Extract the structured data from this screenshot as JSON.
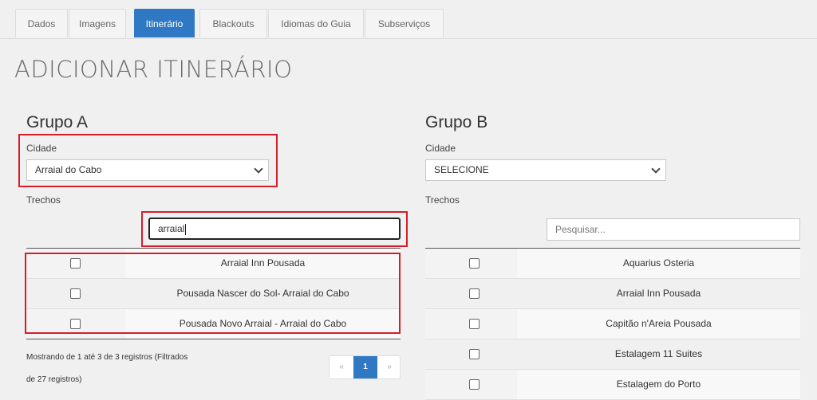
{
  "tabs": [
    {
      "label": "Dados",
      "active": false
    },
    {
      "label": "Imagens",
      "active": false
    },
    {
      "label": "Itinerário",
      "active": true
    },
    {
      "label": "Blackouts",
      "active": false
    },
    {
      "label": "Idiomas do Guia",
      "active": false
    },
    {
      "label": "Subserviços",
      "active": false
    }
  ],
  "page_title": "ADICIONAR ITINERÁRIO",
  "group_a": {
    "title": "Grupo A",
    "city_label": "Cidade",
    "city_value": "Arraial do Cabo",
    "trechos_label": "Trechos",
    "search_value": "arraial",
    "rows": [
      {
        "name": "Arraial Inn Pousada",
        "checked": false
      },
      {
        "name": "Pousada Nascer do Sol- Arraial do Cabo",
        "checked": false
      },
      {
        "name": "Pousada Novo Arraial - Arraial do Cabo",
        "checked": false
      }
    ],
    "info_line1": "Mostrando de 1 até 3 de 3 registros (Filtrados",
    "info_line2": "de 27 registros)",
    "pagination": {
      "prev": "«",
      "current": "1",
      "next": "»"
    }
  },
  "group_b": {
    "title": "Grupo B",
    "city_label": "Cidade",
    "city_value": "SELECIONE",
    "trechos_label": "Trechos",
    "search_placeholder": "Pesquisar...",
    "rows": [
      {
        "name": "Aquarius Osteria",
        "checked": false
      },
      {
        "name": "Arraial Inn Pousada",
        "checked": false
      },
      {
        "name": "Capitão n'Areia Pousada",
        "checked": false
      },
      {
        "name": "Estalagem 11 Suites",
        "checked": false
      },
      {
        "name": "Estalagem do Porto",
        "checked": false
      }
    ]
  },
  "colors": {
    "accent": "#2f79c4",
    "highlight": "#d61e2a",
    "background": "#f0f0f0"
  }
}
